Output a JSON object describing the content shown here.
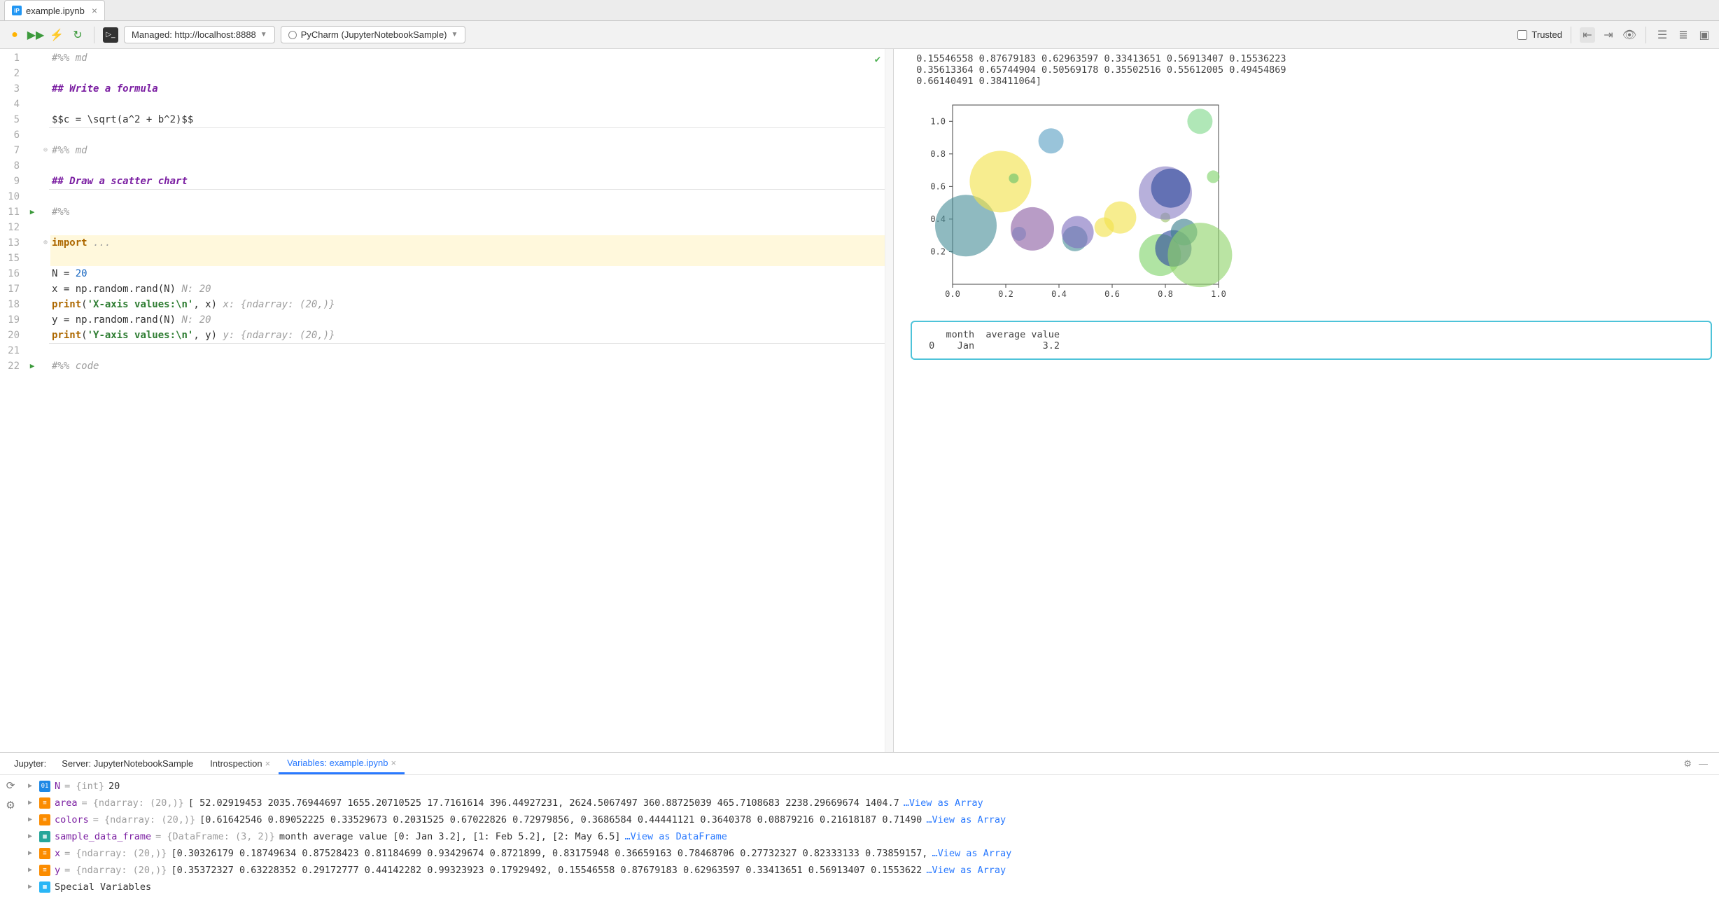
{
  "tab": {
    "filename": "example.ipynb"
  },
  "toolbar": {
    "server_label": "Managed: http://localhost:8888",
    "kernel_label": "PyCharm (JupyterNotebookSample)",
    "trusted_label": "Trusted"
  },
  "editor": {
    "lines": [
      "1",
      "2",
      "3",
      "4",
      "5",
      "6",
      "7",
      "8",
      "9",
      "10",
      "11",
      "12",
      "13",
      "15",
      "16",
      "17",
      "18",
      "19",
      "20",
      "21",
      "22"
    ]
  },
  "code": {
    "l1": "#%% md",
    "l3a": "## ",
    "l3b": "Write a formula",
    "l5": "$$c = \\sqrt(a^2 + b^2)$$",
    "l7": "#%% md",
    "l9a": "## ",
    "l9b": "Draw a scatter chart",
    "l11": "#%%",
    "l13a": "import",
    "l13b": " ...",
    "l16a": "N = ",
    "l16b": "20",
    "l17a": "x = np.random.rand(N)   ",
    "l17b": "N: 20",
    "l18a": "print",
    "l18b": "(",
    "l18c": "'X-axis values:\\n'",
    "l18d": ", x)   ",
    "l18e": "x: {ndarray: (20,)}",
    "l19a": "y = np.random.rand(N)   ",
    "l19b": "N: 20",
    "l20a": "print",
    "l20b": "(",
    "l20c": "'Y-axis values:\\n'",
    "l20d": ", y)   ",
    "l20e": "y: {ndarray: (20,)}",
    "l22": "#%% code"
  },
  "output": {
    "text1": " 0.15546558 0.87679183 0.62963597 0.33413651 0.56913407 0.15536223",
    "text2": " 0.35613364 0.65744904 0.50569178 0.35502516 0.55612005 0.49454869",
    "text3": " 0.66140491 0.38411064]",
    "df_header": "   month  average value",
    "df_row0": "0    Jan            3.2"
  },
  "chart_data": {
    "type": "scatter",
    "xlim": [
      0,
      1
    ],
    "ylim": [
      0,
      1.1
    ],
    "xlabel": "",
    "ylabel": "",
    "ticks_x": [
      "0.0",
      "0.2",
      "0.4",
      "0.6",
      "0.8",
      "1.0"
    ],
    "ticks_y": [
      "0.2",
      "0.4",
      "0.6",
      "0.8",
      "1.0"
    ],
    "points": [
      {
        "x": 0.05,
        "y": 0.36,
        "r": 44,
        "c": "#4a8f99"
      },
      {
        "x": 0.18,
        "y": 0.63,
        "r": 44,
        "c": "#f2e24b"
      },
      {
        "x": 0.23,
        "y": 0.65,
        "r": 7,
        "c": "#66c26b"
      },
      {
        "x": 0.25,
        "y": 0.31,
        "r": 10,
        "c": "#6fb1e0"
      },
      {
        "x": 0.3,
        "y": 0.34,
        "r": 31,
        "c": "#8c5fa3"
      },
      {
        "x": 0.37,
        "y": 0.88,
        "r": 18,
        "c": "#5aa0c4"
      },
      {
        "x": 0.46,
        "y": 0.28,
        "r": 18,
        "c": "#4a8f99"
      },
      {
        "x": 0.47,
        "y": 0.32,
        "r": 23,
        "c": "#7f6fbf"
      },
      {
        "x": 0.57,
        "y": 0.35,
        "r": 14,
        "c": "#f2e24b"
      },
      {
        "x": 0.63,
        "y": 0.41,
        "r": 23,
        "c": "#f2e24b"
      },
      {
        "x": 0.78,
        "y": 0.18,
        "r": 30,
        "c": "#7fd36b"
      },
      {
        "x": 0.8,
        "y": 0.41,
        "r": 7,
        "c": "#9cc26b"
      },
      {
        "x": 0.8,
        "y": 0.56,
        "r": 38,
        "c": "#8b80c5"
      },
      {
        "x": 0.82,
        "y": 0.59,
        "r": 28,
        "c": "#2f4a9c"
      },
      {
        "x": 0.83,
        "y": 0.22,
        "r": 26,
        "c": "#2f4a9c"
      },
      {
        "x": 0.87,
        "y": 0.32,
        "r": 19,
        "c": "#3a7e8c"
      },
      {
        "x": 0.93,
        "y": 0.18,
        "r": 46,
        "c": "#8fd36b"
      },
      {
        "x": 0.93,
        "y": 1.0,
        "r": 18,
        "c": "#7fd98a"
      },
      {
        "x": 0.98,
        "y": 0.66,
        "r": 9,
        "c": "#7fd36b"
      }
    ]
  },
  "bottom": {
    "panel_label": "Jupyter:",
    "tab1": "Server: JupyterNotebookSample",
    "tab2": "Introspection",
    "tab3": "Variables: example.ipynb",
    "special": "Special Variables",
    "vars": [
      {
        "name": "N",
        "badge": "int",
        "type": " = {int} ",
        "value": "20",
        "link": ""
      },
      {
        "name": "area",
        "badge": "arr",
        "type": " = {ndarray: (20,)} ",
        "value": "[  52.02919453 2035.76944697 1655.20710525   17.7161614   396.44927231, 2624.5067497   360.88725039  465.7108683  2238.29669674 1404.7",
        "link": "…View as Array"
      },
      {
        "name": "colors",
        "badge": "arr",
        "type": " = {ndarray: (20,)} ",
        "value": "[0.61642546 0.89052225 0.33529673 0.2031525  0.67022826 0.72979856, 0.3686584  0.44441121 0.3640378  0.08879216 0.21618187 0.71490",
        "link": "…View as Array"
      },
      {
        "name": "sample_data_frame",
        "badge": "df",
        "type": " = {DataFrame: (3, 2)} ",
        "value": "month average value [0: Jan 3.2], [1: Feb 5.2], [2: May 6.5] ",
        "link": "…View as DataFrame"
      },
      {
        "name": "x",
        "badge": "arr",
        "type": " = {ndarray: (20,)} ",
        "value": "[0.30326179 0.18749634 0.87528423 0.81184699 0.93429674 0.8721899, 0.83175948 0.36659163 0.78468706 0.27732327 0.82333133 0.73859157, ",
        "link": "…View as Array"
      },
      {
        "name": "y",
        "badge": "arr",
        "type": " = {ndarray: (20,)} ",
        "value": "[0.35372327 0.63228352 0.29172777 0.44142282 0.99323923 0.17929492, 0.15546558 0.87679183 0.62963597 0.33413651 0.56913407 0.1553622",
        "link": "…View as Array"
      }
    ]
  }
}
